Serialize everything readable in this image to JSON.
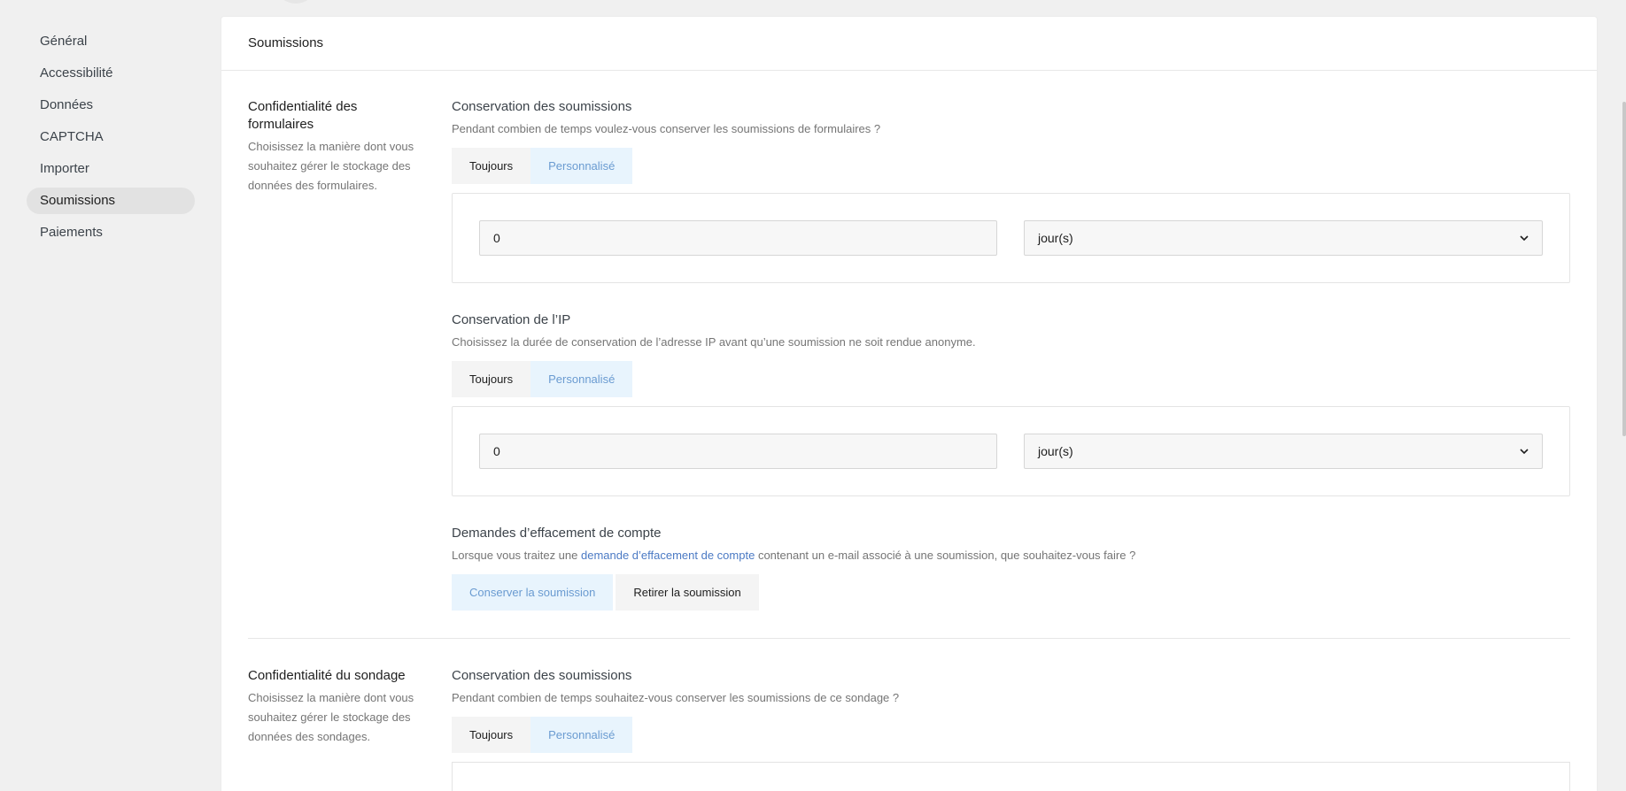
{
  "sidebar": {
    "items": [
      {
        "label": "Général"
      },
      {
        "label": "Accessibilité"
      },
      {
        "label": "Données"
      },
      {
        "label": "CAPTCHA"
      },
      {
        "label": "Importer"
      },
      {
        "label": "Soumissions",
        "active": true
      },
      {
        "label": "Paiements"
      }
    ]
  },
  "card": {
    "title": "Soumissions"
  },
  "forms_privacy": {
    "title": "Confidentialité des formulaires",
    "desc_lines": [
      "Choisissez la manière dont vous",
      "souhaitez gérer le stockage des",
      "données des formulaires."
    ],
    "retention": {
      "title": "Conservation des soumissions",
      "help": "Pendant combien de temps voulez-vous conserver les soumissions de formulaires ?",
      "option_always": "Toujours",
      "option_custom": "Personnalisé",
      "value": "0",
      "unit": "jour(s)"
    },
    "ip_retention": {
      "title": "Conservation de l’IP",
      "help": "Choisissez la durée de conservation de l’adresse IP avant qu’une soumission ne soit rendue anonyme.",
      "option_always": "Toujours",
      "option_custom": "Personnalisé",
      "value": "0",
      "unit": "jour(s)"
    },
    "erasure": {
      "title": "Demandes d’effacement de compte",
      "help_before": "Lorsque vous traitez une ",
      "help_link": "demande d’effacement de compte",
      "help_after": " contenant un e-mail associé à une soumission, que souhaitez-vous faire ?",
      "option_keep": "Conserver la soumission",
      "option_remove": "Retirer la soumission"
    }
  },
  "poll_privacy": {
    "title": "Confidentialité du sondage",
    "desc_lines": [
      "Choisissez la manière dont vous",
      "souhaitez gérer le stockage des",
      "données des sondages."
    ],
    "retention": {
      "title": "Conservation des soumissions",
      "help": "Pendant combien de temps souhaitez-vous conserver les soumissions de ce sondage ?",
      "option_always": "Toujours",
      "option_custom": "Personnalisé"
    }
  }
}
